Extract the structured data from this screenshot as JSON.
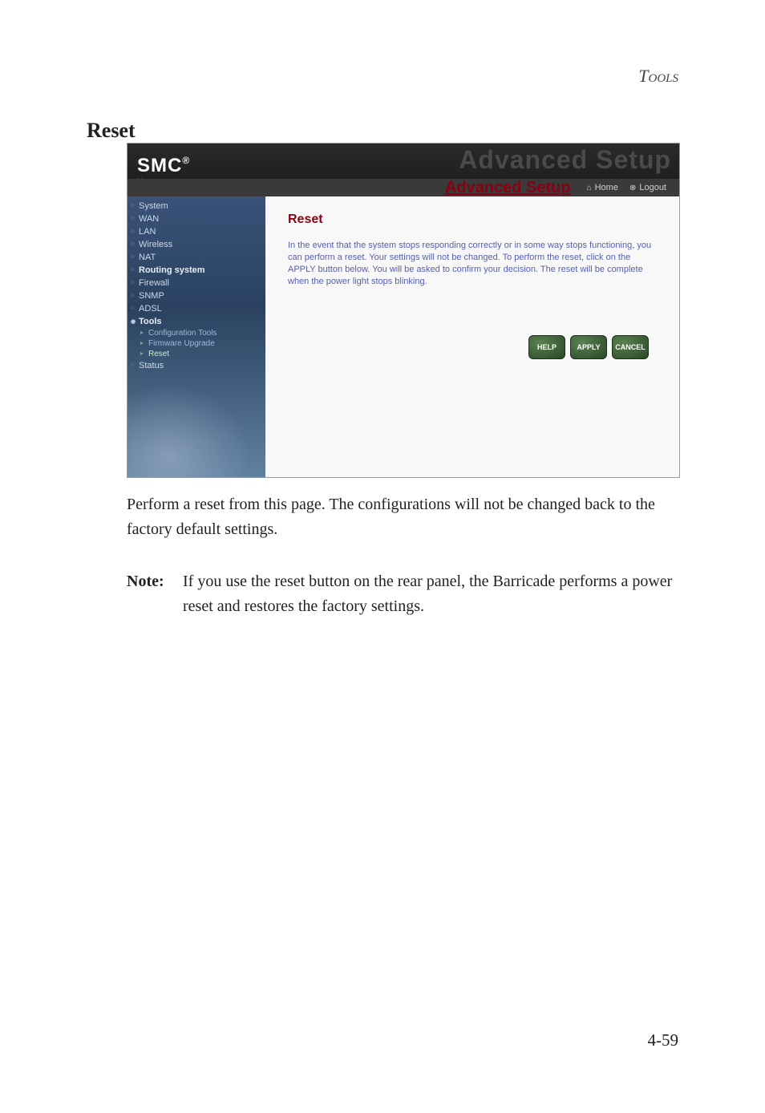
{
  "pageHeader": "Tools",
  "sectionTitle": "Reset",
  "screenshot": {
    "logo": {
      "main": "SMC",
      "reg": "®",
      "sub": "Networks"
    },
    "headerTitleBg": "Advanced Setup",
    "headerTitle": "Advanced Setup",
    "homeLink": "Home",
    "logoutLink": "Logout",
    "nav": {
      "system": "System",
      "wan": "WAN",
      "lan": "LAN",
      "wireless": "Wireless",
      "nat": "NAT",
      "routing": "Routing system",
      "firewall": "Firewall",
      "snmp": "SNMP",
      "adsl": "ADSL",
      "tools": "Tools",
      "configTools": "Configuration Tools",
      "firmware": "Firmware Upgrade",
      "reset": "Reset",
      "status": "Status"
    },
    "content": {
      "title": "Reset",
      "text": "In the event that the system stops responding correctly or in some way stops functioning, you can perform a reset. Your settings will not be changed. To perform the reset, click on the APPLY button below. You will be asked to confirm your decision. The reset will be complete when the power light stops blinking."
    },
    "buttons": {
      "help": "HELP",
      "apply": "APPLY",
      "cancel": "CANCEL"
    }
  },
  "paragraph1": "Perform a reset from this page. The configurations will not be changed back to the factory default settings.",
  "noteLabel": "Note:",
  "noteText": "If you use the reset button on the rear panel, the Barricade performs a power reset and restores the factory settings.",
  "pageNumber": "4-59"
}
